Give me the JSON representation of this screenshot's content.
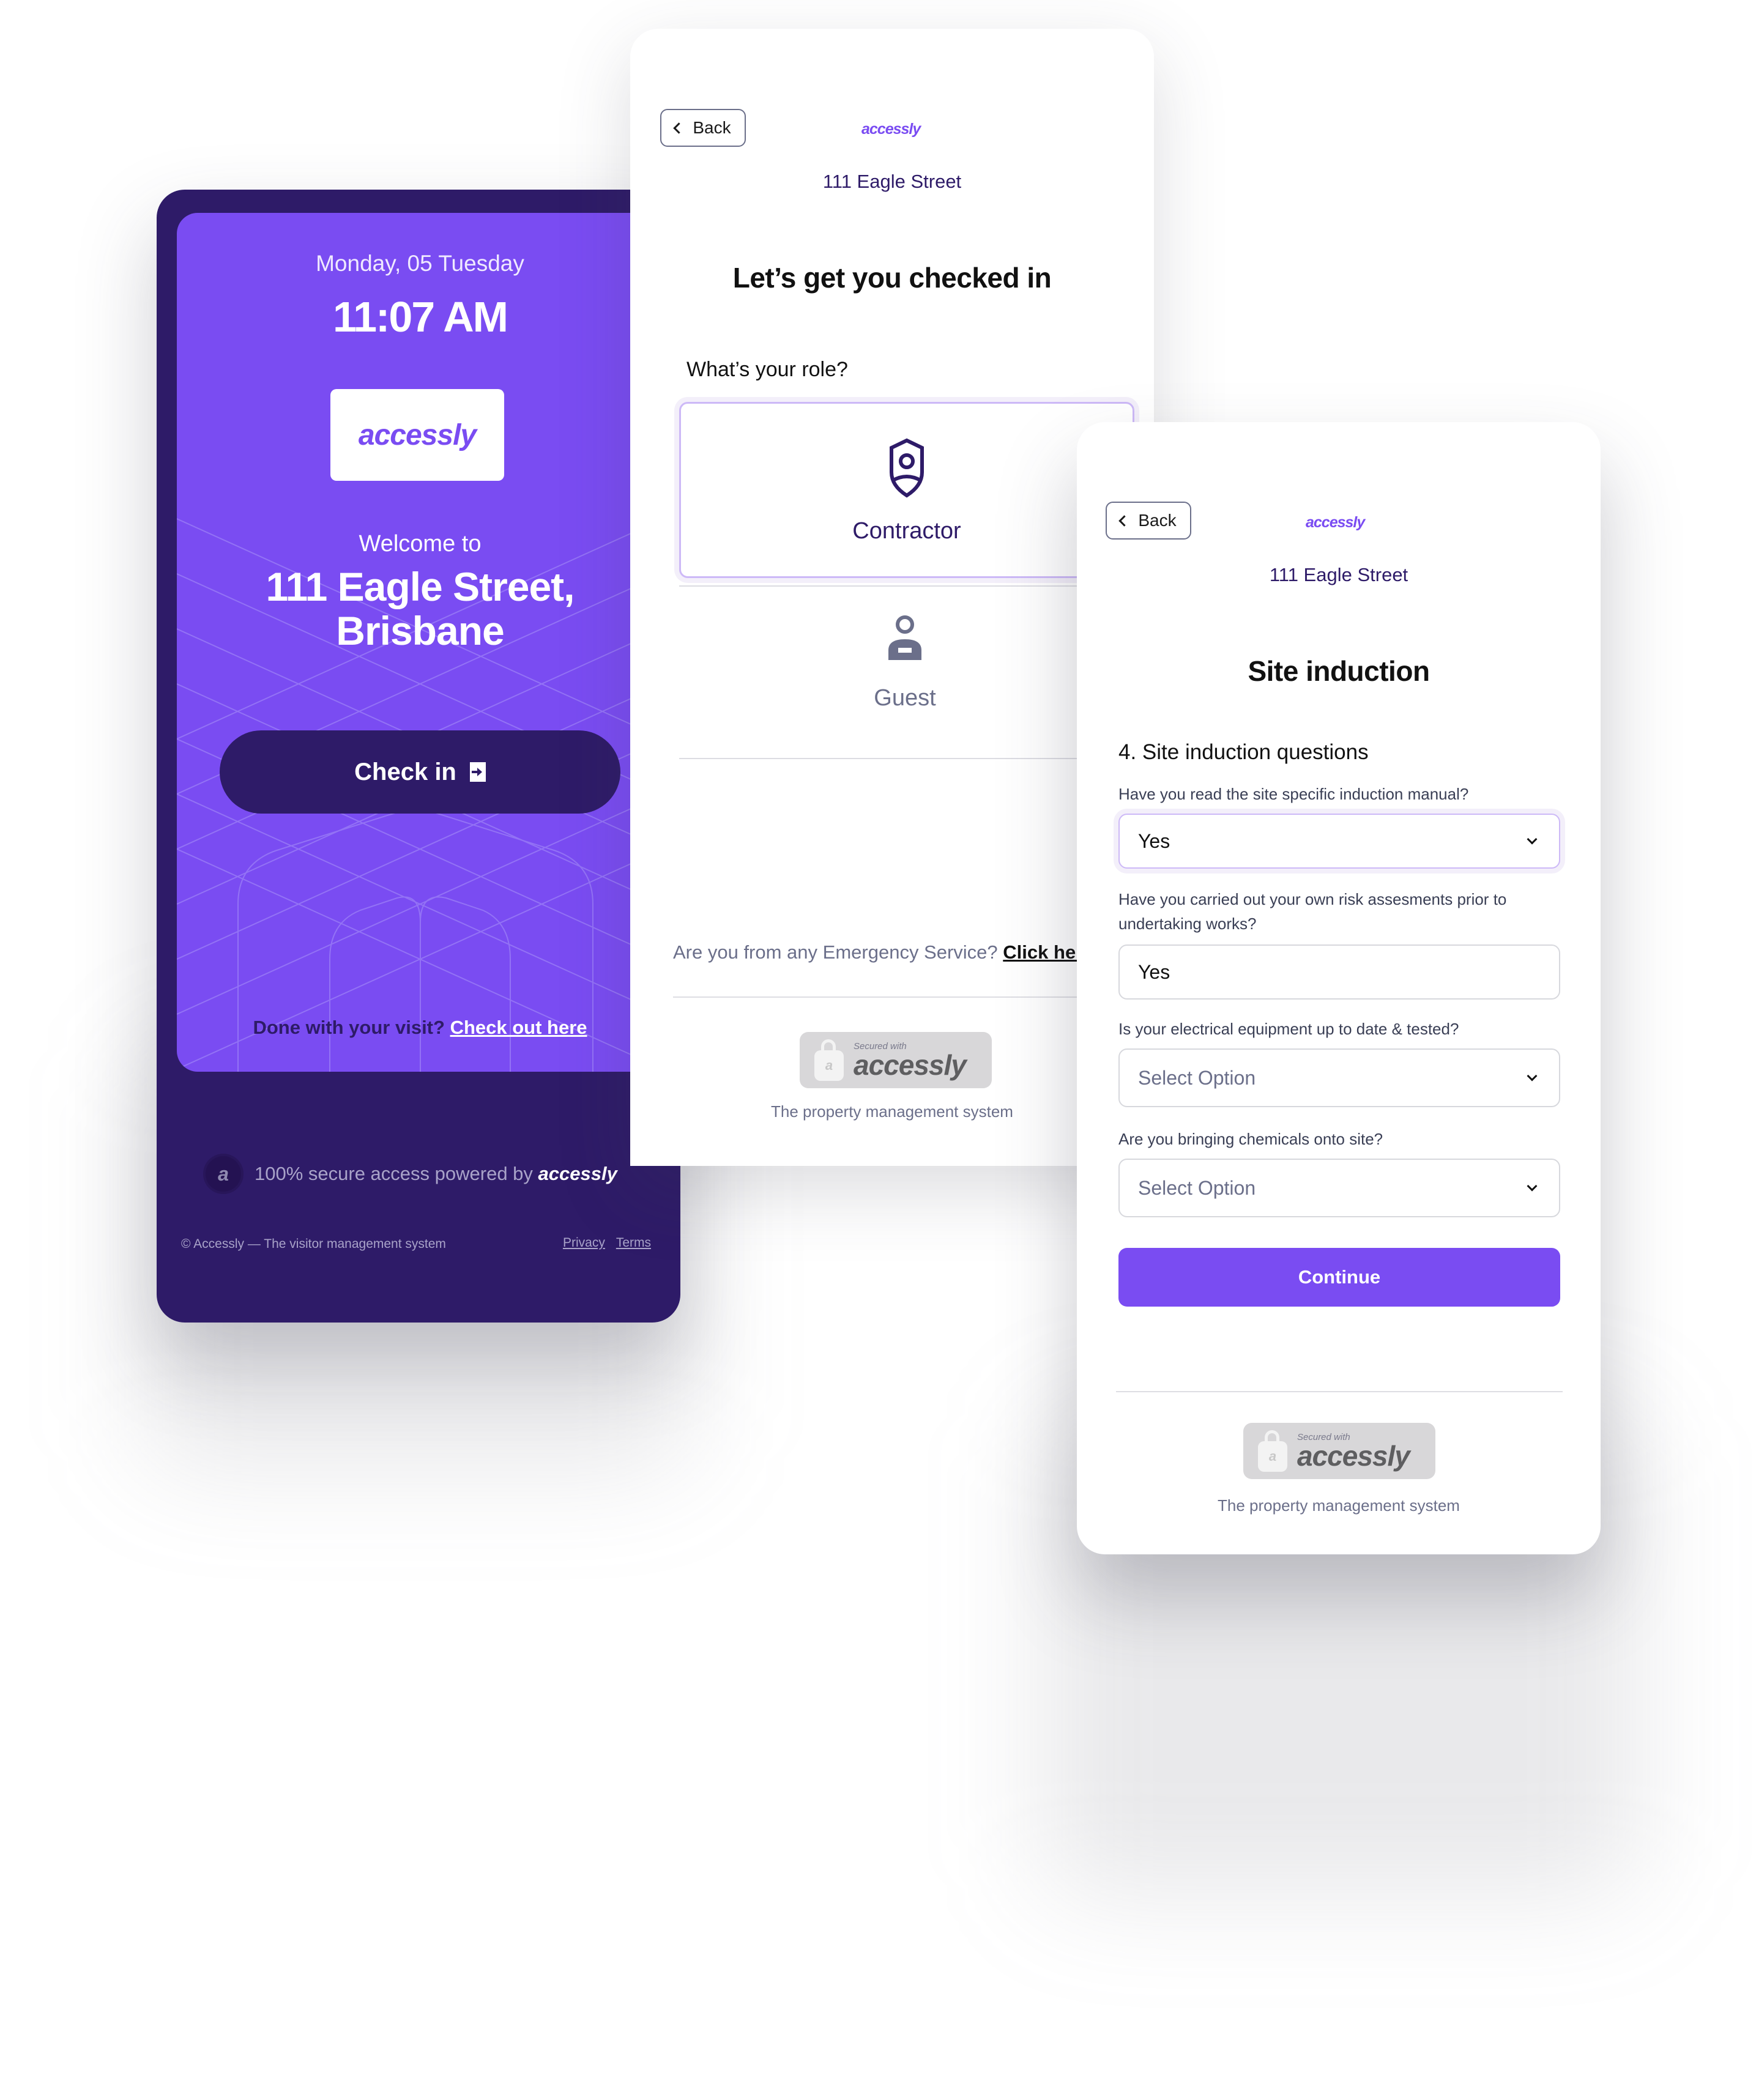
{
  "colors": {
    "brand_purple": "#7a4cf2",
    "deep_purple": "#2e1b68",
    "muted_text": "#6b6f8a"
  },
  "kiosk": {
    "date": "Monday, 05 Tuesday",
    "time": "11:07 AM",
    "logo": "accessly",
    "welcome": "Welcome to",
    "building_line1": "111 Eagle Street,",
    "building_line2": "Brisbane",
    "checkin_label": "Check in",
    "checkin_icon": "sign-in-icon",
    "checkout_prompt": "Done with your visit?",
    "checkout_link": "Check out here",
    "powered_prefix": "100% secure access powered by",
    "powered_brand": "accessly",
    "seal_letter": "a",
    "footer_copyright": "© Accessly — The visitor management system",
    "footer_links": [
      "Privacy",
      "Terms"
    ]
  },
  "role_screen": {
    "back_label": "Back",
    "logo": "accessly",
    "address": "111 Eagle Street",
    "title": "Let’s get you checked in",
    "role_question": "What’s your role?",
    "roles": [
      {
        "label": "Contractor",
        "icon": "shield-user-icon",
        "selected": true
      },
      {
        "label": "Guest",
        "icon": "user-icon",
        "selected": false
      }
    ],
    "emergency_prompt": "Are you from any Emergency Service?",
    "emergency_link": "Click here",
    "badge_small": "Secured with",
    "badge_brand": "accessly",
    "badge_letter": "a",
    "tagline": "The property management system"
  },
  "induction_screen": {
    "back_label": "Back",
    "logo": "accessly",
    "address": "111 Eagle Street",
    "title": "Site induction",
    "section_title": "4. Site induction questions",
    "questions": [
      {
        "label": "Have you read the site specific induction manual?",
        "value": "Yes",
        "type": "select",
        "focused": true
      },
      {
        "label": "Have you carried out your own risk assesments prior to undertaking works?",
        "value": "Yes",
        "type": "text"
      },
      {
        "label": "Is your electrical equipment up to date & tested?",
        "placeholder": "Select Option",
        "type": "select"
      },
      {
        "label": "Are you bringing chemicals onto site?",
        "placeholder": "Select Option",
        "type": "select"
      }
    ],
    "continue_label": "Continue",
    "badge_small": "Secured with",
    "badge_brand": "accessly",
    "badge_letter": "a",
    "tagline": "The property management system"
  }
}
